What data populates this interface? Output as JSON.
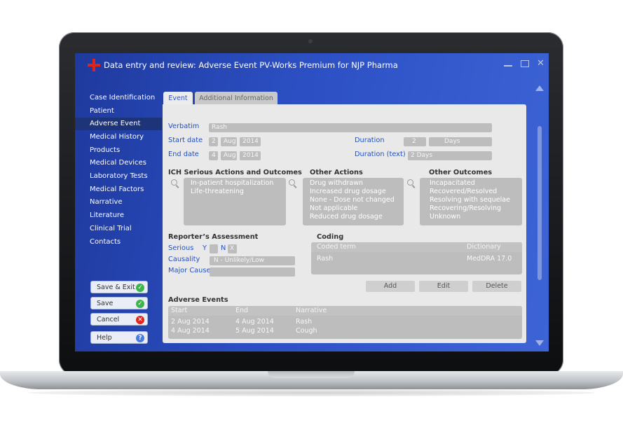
{
  "window": {
    "title": "Data entry and review: Adverse Event PV-Works Premium for NJP Pharma",
    "controls": [
      "minimize-icon",
      "restore-icon",
      "close-icon"
    ]
  },
  "sidebar": {
    "items": [
      {
        "label": "Case Identification"
      },
      {
        "label": "Patient"
      },
      {
        "label": "Adverse Event",
        "active": true
      },
      {
        "label": "Medical History"
      },
      {
        "label": "Products"
      },
      {
        "label": "Medical Devices"
      },
      {
        "label": "Laboratory Tests"
      },
      {
        "label": "Medical Factors"
      },
      {
        "label": "Narrative"
      },
      {
        "label": "Literature"
      },
      {
        "label": "Clinical Trial"
      },
      {
        "label": "Contacts"
      }
    ],
    "buttons": {
      "save_exit": "Save & Exit",
      "save": "Save",
      "cancel": "Cancel",
      "help": "Help",
      "help_icon": "?"
    }
  },
  "tabs": {
    "event": "Event",
    "additional": "Additional Information"
  },
  "event": {
    "verbatim_label": "Verbatim",
    "verbatim_value": "Rash",
    "start_date_label": "Start date",
    "start_day": "2",
    "start_month": "Aug",
    "start_year": "2014",
    "end_date_label": "End date",
    "end_day": "4",
    "end_month": "Aug",
    "end_year": "2014",
    "duration_label": "Duration",
    "duration_value": "2",
    "duration_unit": "Days",
    "duration_text_label": "Duration (text)",
    "duration_text_value": "2 Days"
  },
  "ich": {
    "heading": "ICH Serious Actions and Outcomes",
    "items": [
      "In-patient hospitalization",
      "Life-threatening"
    ]
  },
  "other_actions": {
    "heading": "Other Actions",
    "items": [
      "Drug withdrawn",
      "Increased drug dosage",
      "None - Dose not changed",
      "Not applicable",
      "Reduced drug dosage"
    ]
  },
  "other_outcomes": {
    "heading": "Other Outcomes",
    "items": [
      "Incapacitated",
      "Recovered/Resolved",
      "Resolving with sequelae",
      "Recovering/Resolving",
      "Unknown"
    ]
  },
  "reporter": {
    "heading": "Reporter’s Assessment",
    "serious_label": "Serious",
    "yes": "Y",
    "no": "N",
    "no_mark": "X",
    "causality_label": "Causality",
    "causality_value": "N - Unlikely/Low",
    "major_cause_label": "Major Cause",
    "major_cause_value": ""
  },
  "coding": {
    "heading": "Coding",
    "col_term": "Coded term",
    "col_dict": "Dictionary",
    "term": "Rash",
    "dictionary": "MedDRA 17.0"
  },
  "actions": {
    "add": "Add",
    "edit": "Edit",
    "delete": "Delete"
  },
  "adverse_events": {
    "heading": "Adverse Events",
    "columns": [
      "Start",
      "End",
      "Narrative"
    ],
    "rows": [
      {
        "start": "2 Aug 2014",
        "end": "4 Aug 2014",
        "narrative": "Rash"
      },
      {
        "start": "4 Aug 2014",
        "end": "5 Aug 2014",
        "narrative": "Cough"
      }
    ]
  },
  "colors": {
    "accent": "#2451c0",
    "screen_bg": "#2c50c4",
    "sidebar_active": "#1e3478",
    "save_icon": "#3cb44a",
    "cancel_icon": "#e0241c",
    "help_icon": "#4a7be0"
  }
}
